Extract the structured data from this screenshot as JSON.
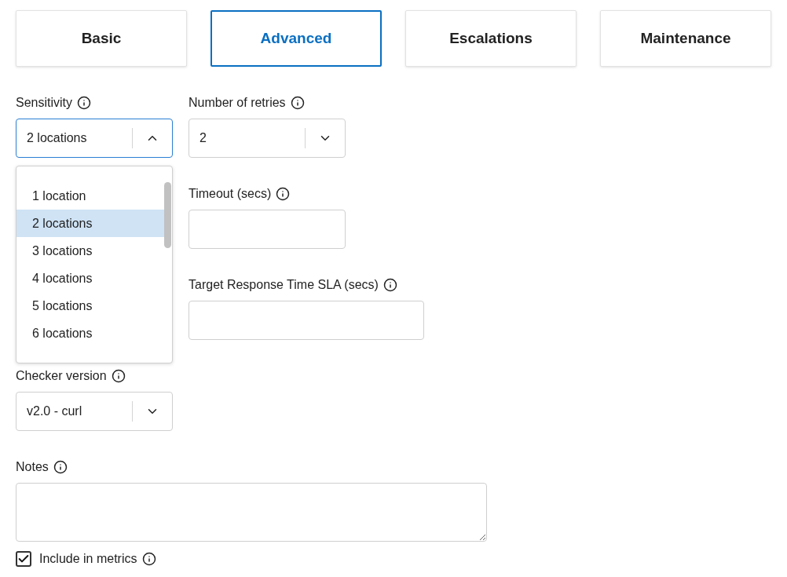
{
  "tabs": [
    {
      "label": "Basic",
      "selected": false
    },
    {
      "label": "Advanced",
      "selected": true
    },
    {
      "label": "Escalations",
      "selected": false
    },
    {
      "label": "Maintenance",
      "selected": false
    }
  ],
  "sensitivity": {
    "label": "Sensitivity",
    "value": "2 locations",
    "expanded": true,
    "options": [
      {
        "label": "1 location",
        "selected": false
      },
      {
        "label": "2 locations",
        "selected": true
      },
      {
        "label": "3 locations",
        "selected": false
      },
      {
        "label": "4 locations",
        "selected": false
      },
      {
        "label": "5 locations",
        "selected": false
      },
      {
        "label": "6 locations",
        "selected": false
      }
    ]
  },
  "right_fields": [
    {
      "kind": "select",
      "label": "Number of retries",
      "value": "2",
      "expanded": false
    },
    {
      "kind": "text",
      "label": "Timeout (secs)"
    },
    {
      "kind": "wide_text",
      "label": "Target Response Time SLA (secs)"
    }
  ],
  "checker_version": {
    "label": "Checker version",
    "value": "v2.0 - curl",
    "expanded": false
  },
  "notes": {
    "label": "Notes"
  },
  "include_in_metrics": {
    "label": "Include in metrics",
    "checked": true
  }
}
